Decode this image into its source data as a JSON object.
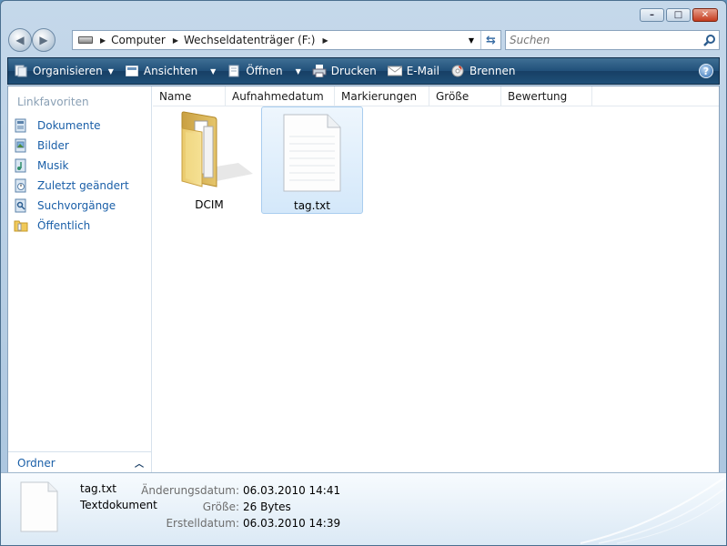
{
  "window": {
    "controls": {
      "minimize": "–",
      "maximize": "□",
      "close": "✕"
    }
  },
  "address_bar": {
    "crumbs": [
      "Computer",
      "Wechseldatenträger (F:)"
    ],
    "search_placeholder": "Suchen"
  },
  "toolbar": {
    "items": [
      {
        "label": "Organisieren",
        "icon": "organize-icon",
        "has_dropdown": true
      },
      {
        "label": "Ansichten",
        "icon": "views-icon",
        "has_dropdown": true
      },
      {
        "label": "Öffnen",
        "icon": "open-icon",
        "has_dropdown": true
      },
      {
        "label": "Drucken",
        "icon": "print-icon",
        "has_dropdown": false
      },
      {
        "label": "E-Mail",
        "icon": "email-icon",
        "has_dropdown": false
      },
      {
        "label": "Brennen",
        "icon": "burn-icon",
        "has_dropdown": false
      }
    ],
    "help": "?"
  },
  "nav_pane": {
    "heading": "Linkfavoriten",
    "items": [
      {
        "label": "Dokumente",
        "icon": "documents-icon"
      },
      {
        "label": "Bilder",
        "icon": "pictures-icon"
      },
      {
        "label": "Musik",
        "icon": "music-icon"
      },
      {
        "label": "Zuletzt geändert",
        "icon": "recently-changed-icon"
      },
      {
        "label": "Suchvorgänge",
        "icon": "searches-icon"
      },
      {
        "label": "Öffentlich",
        "icon": "public-folder-icon"
      }
    ],
    "folders_label": "Ordner"
  },
  "columns": [
    "Name",
    "Aufnahmedatum",
    "Markierungen",
    "Größe",
    "Bewertung"
  ],
  "files": [
    {
      "name": "DCIM",
      "icon": "folder-icon",
      "selected": false
    },
    {
      "name": "tag.txt",
      "icon": "text-file-icon",
      "selected": true
    }
  ],
  "details": {
    "name": "tag.txt",
    "type": "Textdokument",
    "props": [
      {
        "label": "Änderungsdatum:",
        "value": "06.03.2010 14:41"
      },
      {
        "label": "Größe:",
        "value": "26 Bytes"
      },
      {
        "label": "Erstelldatum:",
        "value": "06.03.2010 14:39"
      }
    ]
  },
  "colors": {
    "toolbar_top": "#3f6f94",
    "toolbar_bottom": "#173f65",
    "link_blue": "#1a5fa8",
    "selection": "#d4e8fa"
  }
}
